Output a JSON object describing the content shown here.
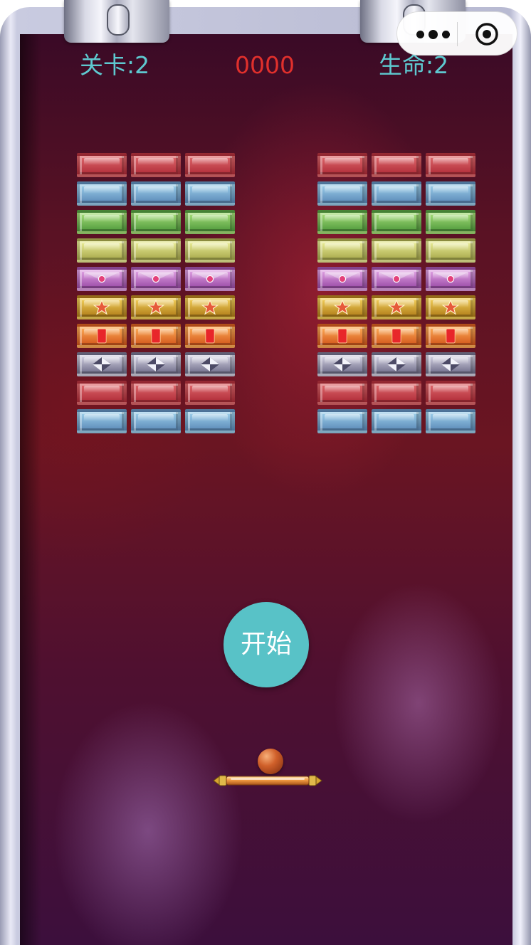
{
  "hud": {
    "level_text": "关卡:2",
    "score_text": "0000",
    "lives_text": "生命:2"
  },
  "controls": {
    "start_label": "开始"
  },
  "capsule": {
    "more_icon": "more-dots-icon",
    "close_icon": "target-close-icon"
  },
  "colors": {
    "hud_text": "#5ec9d0",
    "score_text": "#e0302c",
    "start_button": "#58c2c7"
  },
  "brick_rows": [
    "red",
    "blue",
    "green",
    "yellow",
    "purple-gem",
    "gold-star",
    "orange-gem",
    "silver-diamond",
    "red",
    "blue"
  ],
  "brick_palette": {
    "red": [
      "#e06a6e",
      "#b02c38"
    ],
    "blue": [
      "#9fd1ec",
      "#5b8ab8"
    ],
    "green": [
      "#a9e07a",
      "#4f9a3c"
    ],
    "yellow": [
      "#ecef9a",
      "#a7a84a"
    ],
    "purple-gem": [
      "#e3a6e6",
      "#9a4aa6"
    ],
    "gold-star": [
      "#f4d25c",
      "#b07c18"
    ],
    "orange-gem": [
      "#ffb05a",
      "#d3561a"
    ],
    "silver-diamond": [
      "#d8d6e6",
      "#6e6c88"
    ]
  }
}
